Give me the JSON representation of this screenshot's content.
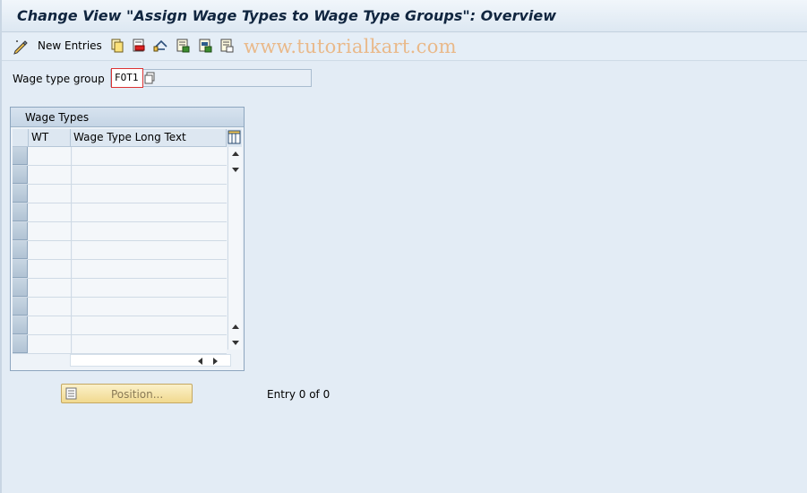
{
  "window": {
    "title": "Change View \"Assign Wage Types to Wage Type Groups\": Overview"
  },
  "toolbar": {
    "items": [
      {
        "icon": "change-display-icon"
      },
      {
        "icon": "new-entries-icon",
        "label": "New Entries"
      },
      {
        "icon": "copy-as-icon"
      },
      {
        "icon": "delete-icon"
      },
      {
        "icon": "undo-change-icon"
      },
      {
        "icon": "select-all-icon"
      },
      {
        "icon": "select-block-icon"
      },
      {
        "icon": "deselect-all-icon"
      }
    ],
    "new_entries_label": "New Entries"
  },
  "watermark": {
    "text": "www.tutorialkart.com"
  },
  "wage_type_group": {
    "label": "Wage type group",
    "value": "FOT1"
  },
  "table": {
    "title": "Wage Types",
    "columns": [
      "WT",
      "Wage Type Long Text"
    ],
    "rows": [
      {
        "wt": "",
        "text": ""
      },
      {
        "wt": "",
        "text": ""
      },
      {
        "wt": "",
        "text": ""
      },
      {
        "wt": "",
        "text": ""
      },
      {
        "wt": "",
        "text": ""
      },
      {
        "wt": "",
        "text": ""
      },
      {
        "wt": "",
        "text": ""
      },
      {
        "wt": "",
        "text": ""
      },
      {
        "wt": "",
        "text": ""
      },
      {
        "wt": "",
        "text": ""
      },
      {
        "wt": "",
        "text": ""
      }
    ]
  },
  "position_button": {
    "label": "Position..."
  },
  "status": {
    "entry_text": "Entry 0 of 0"
  },
  "colors": {
    "title_text": "#10253f",
    "watermark": "#e9b98a",
    "position_button": "#f1d98f",
    "required_field_border": "#dd3333"
  }
}
